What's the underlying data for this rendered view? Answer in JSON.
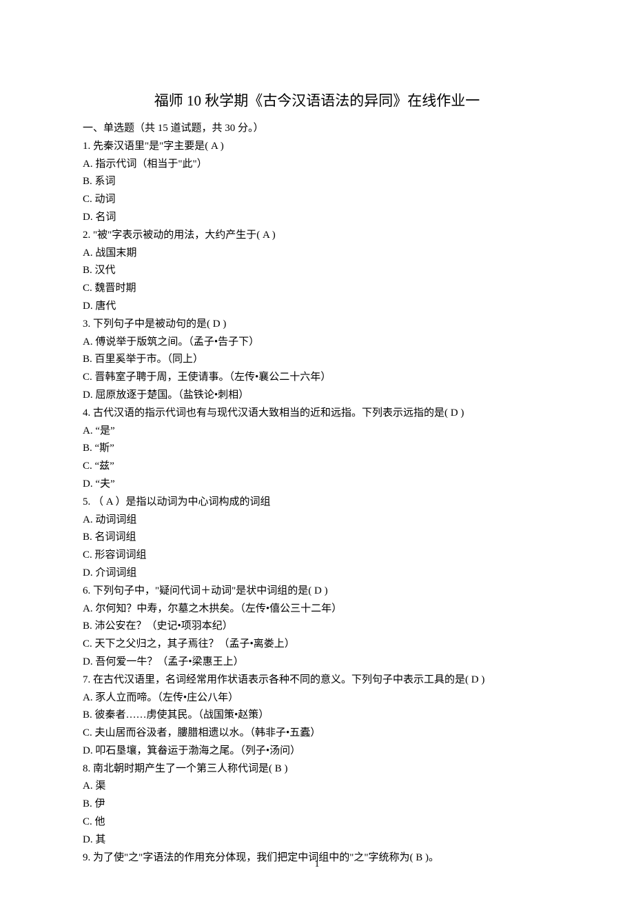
{
  "title": "福师 10 秋学期《古今汉语语法的异同》在线作业一",
  "section_heading": "一、单选题（共 15 道试题，共 30 分。）",
  "questions": [
    {
      "stem": "1. 先秦汉语里\"是\"字主要是( A )",
      "options": [
        "A. 指示代词（相当于\"此\"）",
        "B. 系词",
        "C. 动词",
        "D. 名词"
      ]
    },
    {
      "stem": "2. \"被\"字表示被动的用法，大约产生于( A )",
      "options": [
        "A. 战国末期",
        "B. 汉代",
        "C. 魏晋时期",
        "D. 唐代"
      ]
    },
    {
      "stem": "3. 下列句子中是被动句的是( D )",
      "options": [
        "A. 傅说举于版筑之间。（孟子•告子下）",
        "B. 百里奚举于市。（同上）",
        "C. 晋韩室子聘于周，王使请事。（左传•襄公二十六年）",
        "D. 屈原放逐于楚国。（盐铁论•刺相）"
      ]
    },
    {
      "stem": "4. 古代汉语的指示代词也有与现代汉语大致相当的近和远指。下列表示远指的是( D )",
      "options": [
        "A. “是”",
        "B. “斯”",
        "C. “兹”",
        "D. “夫”"
      ]
    },
    {
      "stem": "5. （ A ）是指以动词为中心词构成的词组",
      "options": [
        "A. 动词词组",
        "B. 名词词组",
        "C. 形容词词组",
        "D. 介词词组"
      ]
    },
    {
      "stem": "6. 下列句子中，\"疑问代词＋动词\"是状中词组的是( D )",
      "options": [
        "A. 尔何知？中寿，尔墓之木拱矣。（左传•僖公三十二年）",
        "B. 沛公安在？（史记•项羽本纪）",
        "C. 天下之父归之，其子焉往？（孟子•离娄上）",
        "D. 吾何爱一牛？（孟子•梁惠王上）"
      ]
    },
    {
      "stem": "7. 在古代汉语里，名词经常用作状语表示各种不同的意义。下列句子中表示工具的是( D )",
      "options": [
        "A. 豕人立而啼。（左传•庄公八年）",
        "B. 彼秦者……虏使其民。（战国策•赵策）",
        "C. 夫山居而谷汲者，膢腊相遗以水。（韩非子•五蠹）",
        "D. 叩石垦壤，箕畚运于渤海之尾。（列子•汤问）"
      ]
    },
    {
      "stem": "8. 南北朝时期产生了一个第三人称代词是( B )",
      "options": [
        "A. 渠",
        "B. 伊",
        "C. 他",
        "D. 其"
      ]
    },
    {
      "stem": "9. 为了使\"之\"字语法的作用充分体现，我们把定中词组中的\"之\"字统称为( B )。",
      "options": []
    }
  ],
  "page_number": "1"
}
